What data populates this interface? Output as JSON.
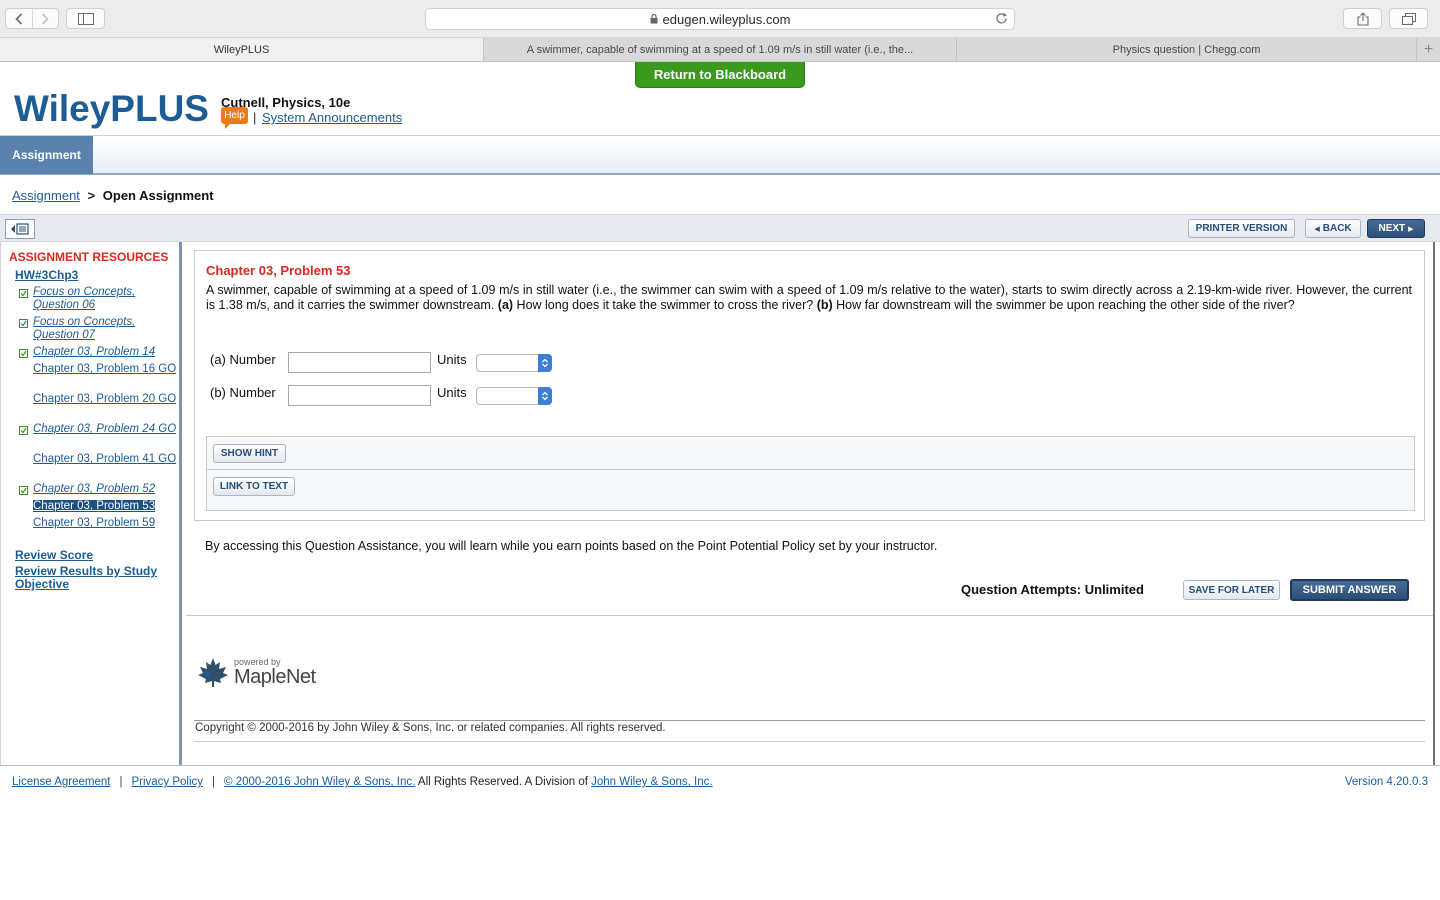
{
  "browser": {
    "url": "edugen.wileyplus.com",
    "tabs": [
      {
        "label": "WileyPLUS",
        "active": true
      },
      {
        "label": "A swimmer, capable of swimming at a speed of 1.09 m/s in still water (i.e., the...",
        "active": false
      },
      {
        "label": "Physics question | Chegg.com",
        "active": false
      }
    ],
    "new_tab": "+"
  },
  "header": {
    "return_button": "Return to Blackboard",
    "logo": "WileyPLUS",
    "course_title": "Cutnell, Physics, 10e",
    "help_label": "Help",
    "separator": "|",
    "announcements_link": "System Announcements"
  },
  "nav": {
    "active_tab": "Assignment"
  },
  "breadcrumb": {
    "parent": "Assignment",
    "separator": ">",
    "current": "Open Assignment"
  },
  "actionbar": {
    "printer_label": "PRINTER VERSION",
    "back_label": "BACK",
    "next_label": "NEXT"
  },
  "sidebar": {
    "title": "ASSIGNMENT RESOURCES",
    "hw_link": "HW#3Chp3",
    "items": [
      {
        "label": "Focus on Concepts, Question 06",
        "done": true,
        "current": false
      },
      {
        "label": "Focus on Concepts, Question 07",
        "done": true,
        "current": false
      },
      {
        "label": "Chapter 03, Problem 14",
        "done": true,
        "current": false
      },
      {
        "label": "Chapter 03, Problem 16 GO",
        "done": false,
        "current": false
      },
      {
        "label": "Chapter 03, Problem 20 GO",
        "done": false,
        "current": false
      },
      {
        "label": "Chapter 03, Problem 24 GO",
        "done": true,
        "current": false
      },
      {
        "label": "Chapter 03, Problem 41 GO",
        "done": false,
        "current": false
      },
      {
        "label": "Chapter 03, Problem 52",
        "done": true,
        "current": false
      },
      {
        "label": "Chapter 03, Problem 53",
        "done": false,
        "current": true
      },
      {
        "label": "Chapter 03, Problem 59",
        "done": false,
        "current": false
      }
    ],
    "review_score": "Review Score",
    "review_results": "Review Results by Study Objective"
  },
  "question": {
    "title": "Chapter 03, Problem 53",
    "text_intro": "A swimmer, capable of swimming at a speed of 1.09 m/s in still water (i.e., the swimmer can swim with a speed of 1.09 m/s relative to the water), starts to swim directly across a 2.19-km-wide river. However, the current is 1.38 m/s, and it carries the swimmer downstream.",
    "part_a_marker": "(a)",
    "part_a_text": "How long does it take the swimmer to cross the river?",
    "part_b_marker": "(b)",
    "part_b_text": "How far downstream will the swimmer be upon reaching the other side of the river?",
    "answer_a_label": "(a) Number",
    "answer_b_label": "(b) Number",
    "units_label": "Units",
    "answer_a_value": "",
    "answer_b_value": "",
    "show_hint": "SHOW HINT",
    "link_to_text": "LINK TO TEXT"
  },
  "policy_text": "By accessing this Question Assistance, you will learn while you earn points based on the Point Potential Policy set by your instructor.",
  "attempts_text": "Question Attempts: Unlimited",
  "save_later": "SAVE FOR LATER",
  "submit_answer": "SUBMIT ANSWER",
  "maplenet": {
    "powered_by": "powered by",
    "name": "MapleNet"
  },
  "copyright": "Copyright © 2000-2016 by John Wiley & Sons, Inc. or related companies. All rights reserved.",
  "footer": {
    "license": "License Agreement",
    "privacy": "Privacy Policy",
    "sep": "|",
    "copyright_link": "© 2000-2016 John Wiley & Sons, Inc.",
    "rights_text": " All Rights Reserved. A Division of ",
    "division_link": "John Wiley & Sons, Inc.",
    "version": "Version 4.20.0.3"
  },
  "colors": {
    "brand_blue": "#1d5c95",
    "accent_red": "#d62b1f",
    "blackboard_green": "#3a9a1e",
    "help_orange": "#f07a12"
  }
}
